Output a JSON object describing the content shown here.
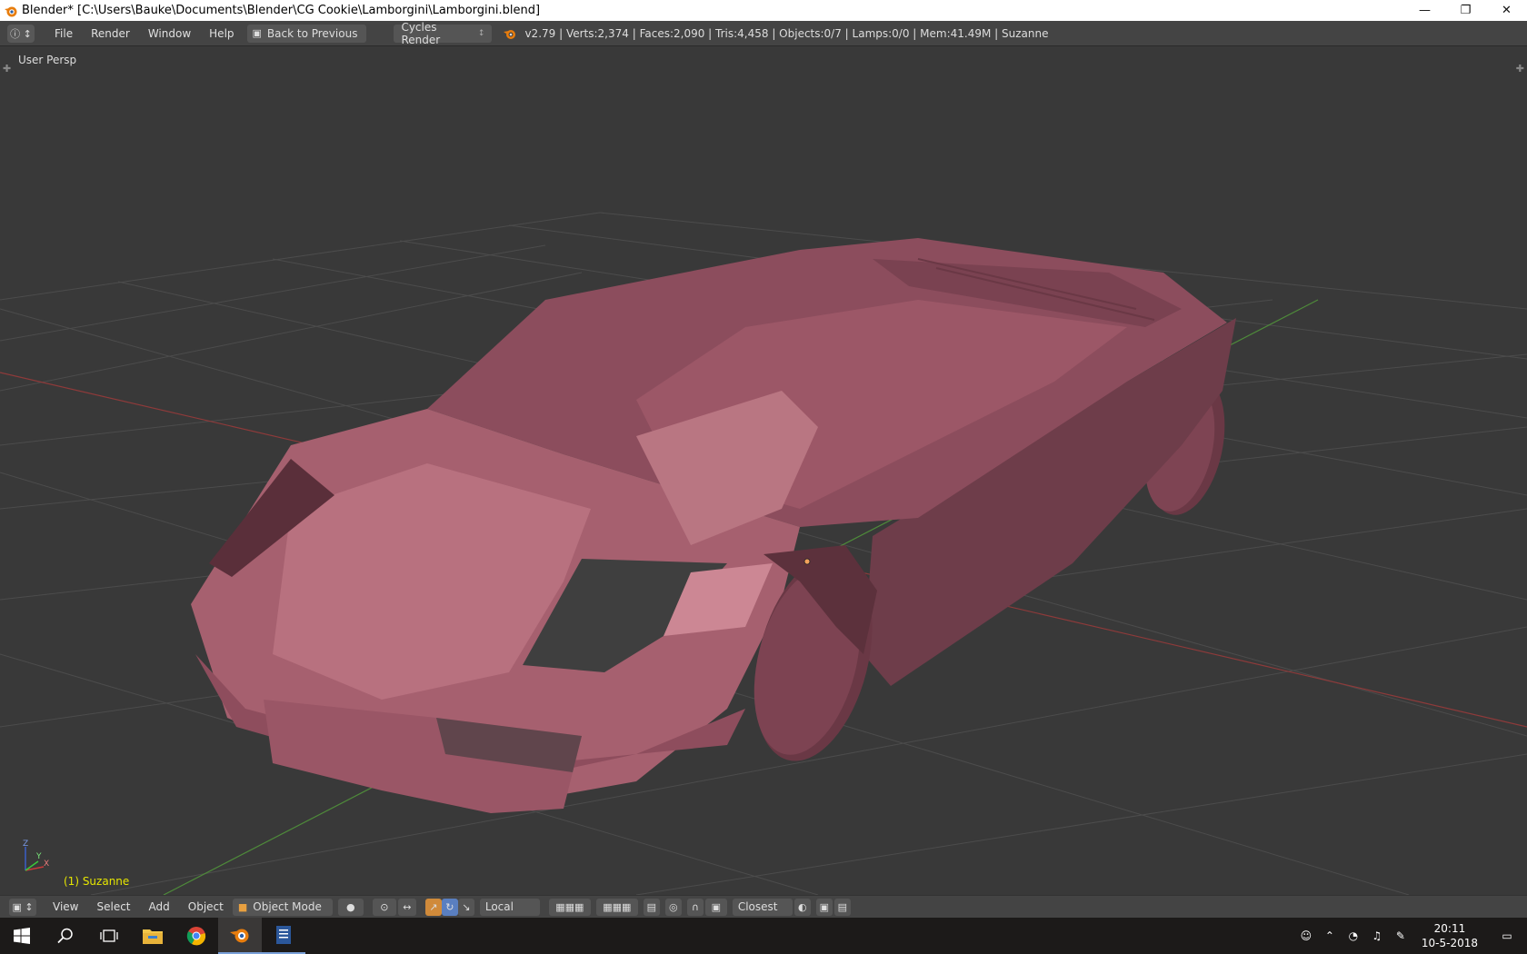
{
  "window": {
    "title": "Blender* [C:\\Users\\Bauke\\Documents\\Blender\\CG Cookie\\Lamborgini\\Lamborgini.blend]",
    "minimize_icon": "minimize-icon",
    "maximize_icon": "restore-icon",
    "close_icon": "close-icon"
  },
  "info_header": {
    "menu": [
      "File",
      "Render",
      "Window",
      "Help"
    ],
    "back_button": "Back to Previous",
    "render_engine": "Cycles Render",
    "stats": "v2.79 | Verts:2,374 | Faces:2,090 | Tris:4,458 | Objects:0/7 | Lamps:0/0 | Mem:41.49M | Suzanne"
  },
  "viewport": {
    "view_label": "User Persp",
    "object_label": "(1) Suzanne",
    "axis_labels": [
      "Z",
      "X",
      "Y"
    ],
    "model_color": "#b86a7c",
    "background": "#393939",
    "x_axis_color": "#8e3a3a",
    "y_axis_color": "#4e8a3a"
  },
  "view3d_header": {
    "menu": [
      "View",
      "Select",
      "Add",
      "Object"
    ],
    "mode": "Object Mode",
    "pivot": "Local",
    "snap": "Closest"
  },
  "taskbar": {
    "apps": [
      "start-icon",
      "search-icon",
      "task-view-icon",
      "file-explorer-icon",
      "chrome-icon",
      "blender-icon",
      "notepad-icon"
    ],
    "time": "20:11",
    "date": "10-5-2018"
  }
}
